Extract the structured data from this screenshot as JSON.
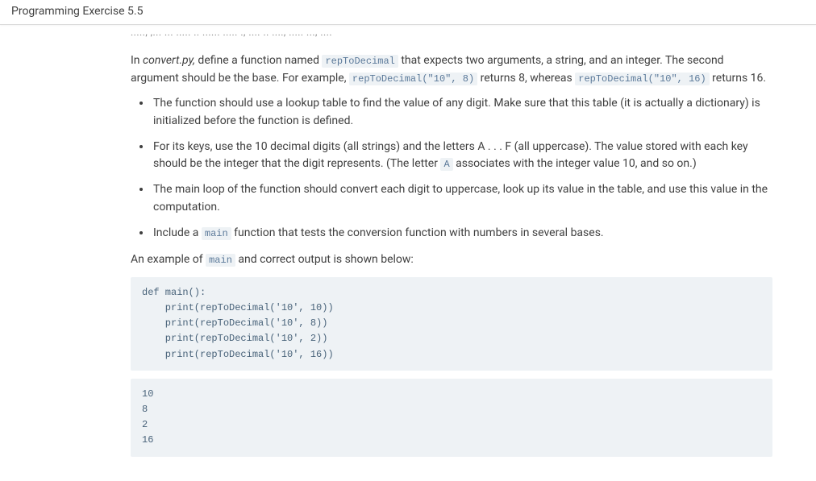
{
  "header": {
    "title": "Programming Exercise 5.5"
  },
  "truncated_prev": "....., ,... ... ..... .. ...... ..... ., .... .. ...., ..... ..., ....",
  "intro": {
    "pre1": "In ",
    "filename": "convert.py,",
    "post1": " define a function named ",
    "code1": "repToDecimal",
    "mid1": " that expects two arguments, a string, and an integer. The second argument should be the base. For example, ",
    "code2": "repToDecimal(\"10\", 8)",
    "mid2": " returns 8, whereas ",
    "code3": "repToDecimal(\"10\", 16)",
    "mid3": " returns 16."
  },
  "bullets": [
    {
      "text": "The function should use a lookup table to find the value of any digit. Make sure that this table (it is actually a dictionary) is initialized before the function is defined."
    },
    {
      "pre": "For its keys, use the 10 decimal digits (all strings) and the letters A . . . F (all uppercase). The value stored with each key should be the integer that the digit represents. (The letter ",
      "code": "A",
      "post": " associates with the integer value 10, and so on.)"
    },
    {
      "text": "The main loop of the function should convert each digit to uppercase, look up its value in the table, and use this value in the computation."
    },
    {
      "pre": "Include a ",
      "code": "main",
      "post": " function that tests the conversion function with numbers in several bases."
    }
  ],
  "example_line": {
    "pre": "An example of ",
    "code": "main",
    "post": " and correct output is shown below:"
  },
  "code_block1": "def main():\n    print(repToDecimal('10', 10))\n    print(repToDecimal('10', 8))\n    print(repToDecimal('10', 2))\n    print(repToDecimal('10', 16))",
  "code_block2": "10\n8\n2\n16"
}
